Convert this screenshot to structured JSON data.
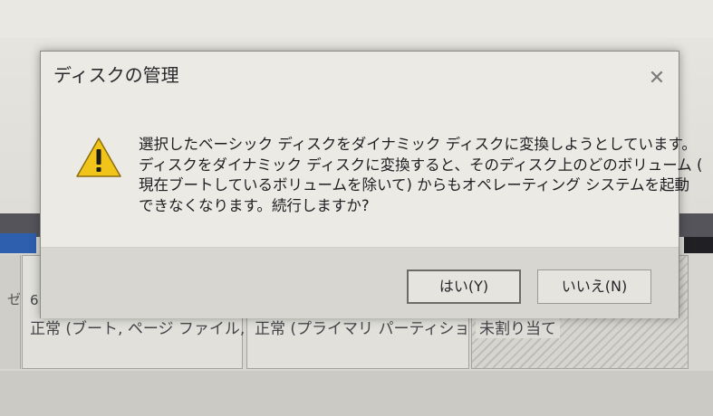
{
  "dialog": {
    "title": "ディスクの管理",
    "close_symbol": "✕",
    "icon": "warning-icon",
    "message_lines": [
      "選択したベーシック ディスクをダイナミック ディスクに変換しようとしています。",
      "ディスクをダイナミック ディスクに変換すると、そのディスク上のどのボリューム (",
      "現在ブートしているボリュームを除いて) からもオペレーティング システムを起動",
      "できなくなります。続行しますか?"
    ],
    "yes_label": "はい(Y)",
    "no_label": "いいえ(N)"
  },
  "background": {
    "label_col_char": "ゼ",
    "disk_number": "6",
    "partitions": [
      {
        "status": "正常 (ブート, ページ ファイル,"
      },
      {
        "status": "正常 (プライマリ パーティショ"
      },
      {
        "status": "未割り当て"
      }
    ]
  },
  "colors": {
    "warning_yellow": "#f0c419",
    "disk_bar_blue": "#2e5fae",
    "dialog_bg": "#eceae4",
    "footer_bg": "#d7d6d0"
  }
}
